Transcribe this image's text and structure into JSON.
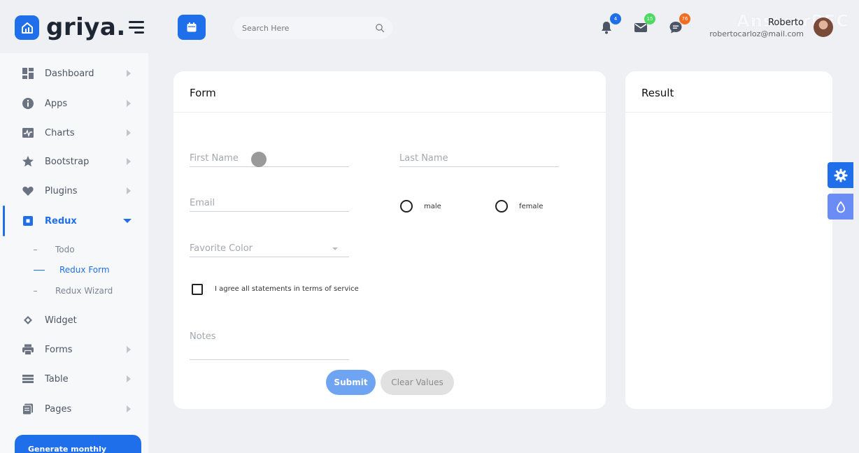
{
  "brand": {
    "name": "griya."
  },
  "header": {
    "search_placeholder": "Search Here",
    "notifications": {
      "count": "4",
      "color": "#1f6fea"
    },
    "messages": {
      "count": "15",
      "color": "#4cd964"
    },
    "chats": {
      "count": "76",
      "color": "#f36c21"
    },
    "user": {
      "name": "Roberto",
      "email": "robertocarloz@mail.com"
    },
    "watermark": "AnswerPEC"
  },
  "sidebar": {
    "items": [
      {
        "label": "Dashboard",
        "icon": "dashboard-icon"
      },
      {
        "label": "Apps",
        "icon": "info-icon"
      },
      {
        "label": "Charts",
        "icon": "chart-icon"
      },
      {
        "label": "Bootstrap",
        "icon": "star-icon"
      },
      {
        "label": "Plugins",
        "icon": "heart-icon"
      },
      {
        "label": "Redux",
        "icon": "redux-icon"
      },
      {
        "label": "Widget",
        "icon": "widget-icon"
      },
      {
        "label": "Forms",
        "icon": "printer-icon"
      },
      {
        "label": "Table",
        "icon": "table-icon"
      },
      {
        "label": "Pages",
        "icon": "pages-icon"
      }
    ],
    "redux_sub": [
      {
        "label": "Todo"
      },
      {
        "label": "Redux Form"
      },
      {
        "label": "Redux Wizard"
      }
    ],
    "promo": "Generate monthly"
  },
  "form": {
    "title": "Form",
    "first_name_placeholder": "First Name",
    "last_name_placeholder": "Last Name",
    "email_placeholder": "Email",
    "gender_options": [
      "male",
      "female"
    ],
    "favorite_color_placeholder": "Favorite Color",
    "agree_label": "I agree all statements in terms of service",
    "notes_placeholder": "Notes",
    "submit_label": "Submit",
    "clear_label": "Clear Values"
  },
  "result": {
    "title": "Result"
  },
  "colors": {
    "accent": "#1f6fea",
    "submit": "#6fa4f2",
    "settings_button": "#1f6fea",
    "theme_button": "#6c8cf5"
  }
}
